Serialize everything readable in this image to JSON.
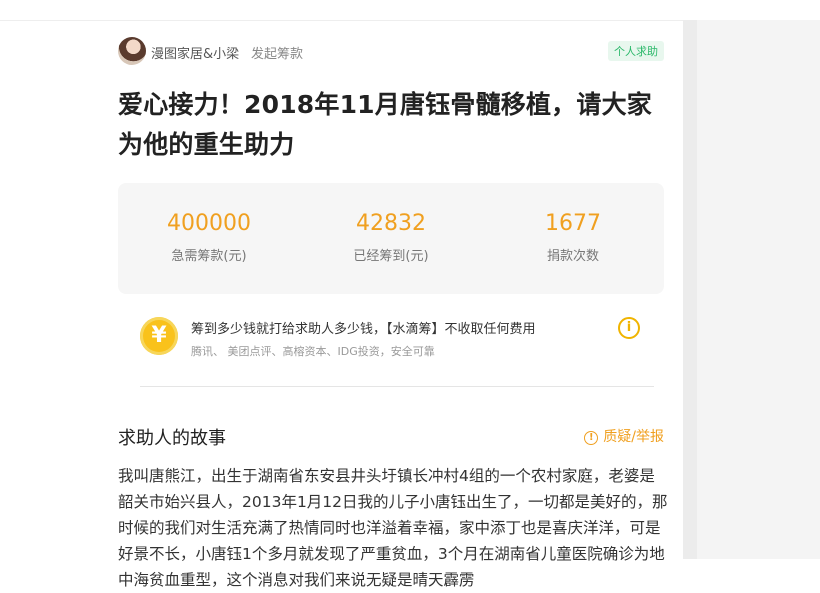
{
  "author": {
    "name": "漫图家居&小梁",
    "action": "发起筹款",
    "tag": "个人求助"
  },
  "title": "爱心接力！2018年11月唐钰骨髓移植，请大家为他的重生助力",
  "stats": [
    {
      "value": "400000",
      "label": "急需筹款(元)"
    },
    {
      "value": "42832",
      "label": "已经筹到(元)"
    },
    {
      "value": "1677",
      "label": "捐款次数"
    }
  ],
  "notice": {
    "coin_glyph": "¥",
    "main": "筹到多少钱就打给求助人多少钱，【水滴筹】不收取任何费用",
    "sub": "腾讯、 美团点评、高榕资本、IDG投资，安全可靠",
    "info_glyph": "i"
  },
  "story": {
    "heading": "求助人的故事",
    "report_label": "质疑/举报",
    "report_glyph": "!",
    "body": "我叫唐熊江，出生于湖南省东安县井头圩镇长冲村4组的一个农村家庭，老婆是韶关市始兴县人，2013年1月12日我的儿子小唐钰出生了，一切都是美好的，那时候的我们对生活充满了热情同时也洋溢着幸福，家中添丁也是喜庆洋洋，可是好景不长，小唐钰1个多月就发现了严重贫血，3个月在湖南省儿童医院确诊为地中海贫血重型，这个消息对我们来说无疑是晴天霹雳"
  }
}
